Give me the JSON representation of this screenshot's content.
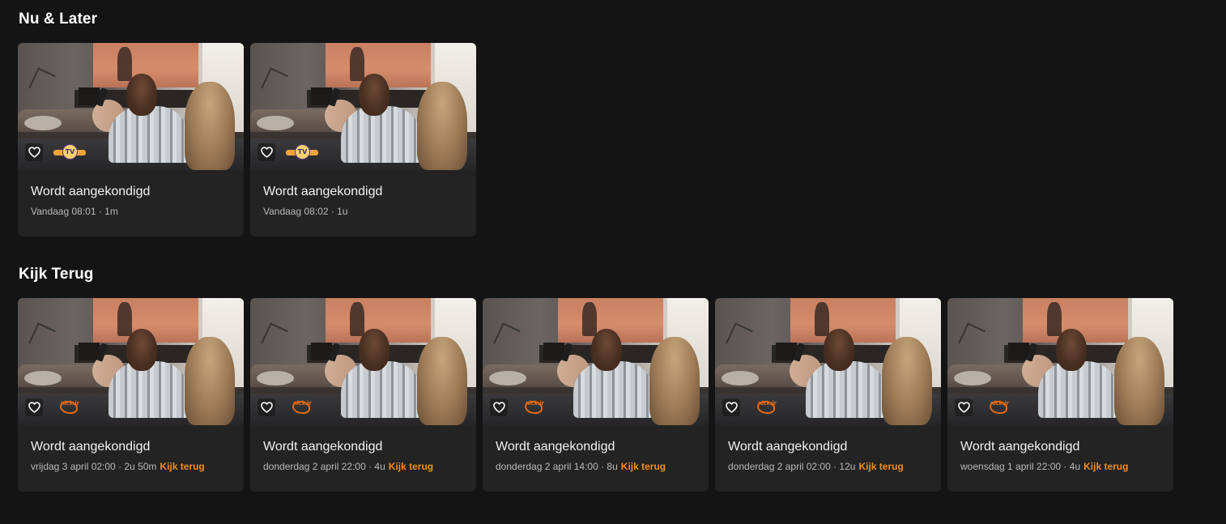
{
  "sections": {
    "now_later": {
      "title": "Nu & Later",
      "cards": [
        {
          "title": "Wordt aangekondigd",
          "meta": "Vandaag 08:01 · 1m",
          "channel": "TV channel logo"
        },
        {
          "title": "Wordt aangekondigd",
          "meta": "Vandaag 08:02 · 1u",
          "channel": "TV channel logo"
        }
      ]
    },
    "kijk_terug": {
      "title": "Kijk Terug",
      "cta_label": "Kijk terug",
      "cards": [
        {
          "title": "Wordt aangekondigd",
          "meta": "vrijdag 3 april 02:00 · 2u 50m",
          "cta": "Kijk terug",
          "channel": "nick jr logo"
        },
        {
          "title": "Wordt aangekondigd",
          "meta": "donderdag 2 april 22:00 · 4u",
          "cta": "Kijk terug",
          "channel": "nick jr logo"
        },
        {
          "title": "Wordt aangekondigd",
          "meta": "donderdag 2 april 14:00 · 8u",
          "cta": "Kijk terug",
          "channel": "nick jr logo"
        },
        {
          "title": "Wordt aangekondigd",
          "meta": "donderdag 2 april 02:00 · 12u",
          "cta": "Kijk terug",
          "channel": "nick jr logo"
        },
        {
          "title": "Wordt aangekondigd",
          "meta": "woensdag 1 april 22:00 · 4u",
          "cta": "Kijk terug",
          "channel": "nick jr logo"
        }
      ]
    }
  },
  "channel_logos": {
    "tv_logo_text": "TV",
    "nick_logo_text": "nick.jr"
  },
  "colors": {
    "background": "#141414",
    "card": "#232323",
    "accent": "#f08c1e"
  },
  "icons": {
    "favorite": "heart-outline-icon"
  }
}
